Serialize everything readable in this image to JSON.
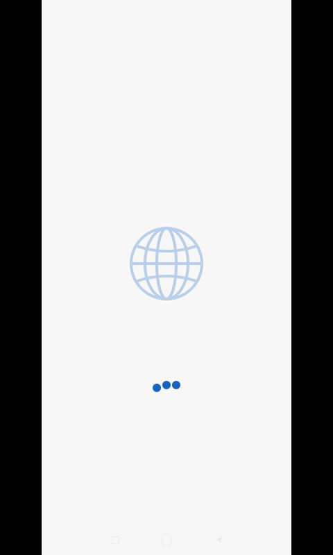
{
  "status_bar": {
    "time": "",
    "icons": ""
  },
  "splash": {
    "logo_icon": "globe-icon",
    "loading_indicator": "three-dot-loader"
  },
  "navigation_bar": {
    "recents_icon": "recents-icon",
    "home_icon": "home-icon",
    "back_icon": "back-icon"
  },
  "colors": {
    "background": "#f7f7f7",
    "globe_stroke": "#b7cfe8",
    "loader_dot": "#1565c0",
    "frame": "#000000"
  }
}
